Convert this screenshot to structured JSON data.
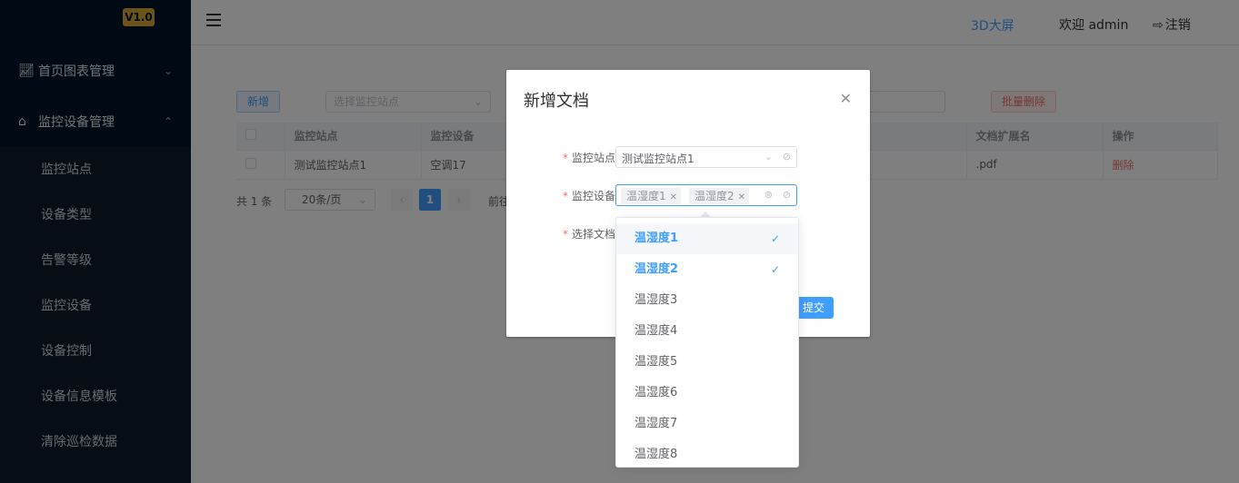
{
  "sidebar": {
    "version": "V1.0",
    "groups": [
      {
        "label": "首页图表管理",
        "icon": "line-chart-icon",
        "expanded": false
      },
      {
        "label": "监控设备管理",
        "icon": "home-icon",
        "expanded": true
      }
    ],
    "items": [
      {
        "label": "监控站点"
      },
      {
        "label": "设备类型"
      },
      {
        "label": "告警等级"
      },
      {
        "label": "监控设备"
      },
      {
        "label": "设备控制"
      },
      {
        "label": "设备信息模板"
      },
      {
        "label": "清除巡检数据"
      }
    ]
  },
  "header": {
    "link_3d": "3D大屏",
    "welcome": "欢迎 admin",
    "logout": "注销"
  },
  "toolbar": {
    "add_label": "新增",
    "station_placeholder": "选择监控站点",
    "batch_delete_label": "批量删除"
  },
  "table": {
    "columns": [
      "监控站点",
      "监控设备",
      "文档扩展名",
      "操作"
    ],
    "rows": [
      {
        "station": "测试监控站点1",
        "device": "空调17",
        "ext": ".pdf",
        "action": "删除"
      }
    ]
  },
  "pagination": {
    "total": "共 1 条",
    "page_size": "20条/页",
    "current_page": "1",
    "goto": "前往"
  },
  "dialog": {
    "title": "新增文档",
    "fields": {
      "station": {
        "label": "监控站点",
        "value": "测试监控站点1"
      },
      "device": {
        "label": "监控设备",
        "tags": [
          "温湿度1",
          "温湿度2"
        ]
      },
      "document": {
        "label": "选择文档"
      }
    },
    "submit_label": "提交"
  },
  "dropdown": {
    "options": [
      {
        "label": "温湿度1",
        "selected": true
      },
      {
        "label": "温湿度2",
        "selected": true
      },
      {
        "label": "温湿度3",
        "selected": false
      },
      {
        "label": "温湿度4",
        "selected": false
      },
      {
        "label": "温湿度5",
        "selected": false
      },
      {
        "label": "温湿度6",
        "selected": false
      },
      {
        "label": "温湿度7",
        "selected": false
      },
      {
        "label": "温湿度8",
        "selected": false
      }
    ]
  },
  "colors": {
    "primary": "#409eff",
    "danger": "#f56c6c",
    "sidebar_bg": "#001529",
    "badge": "#d9a62e"
  }
}
